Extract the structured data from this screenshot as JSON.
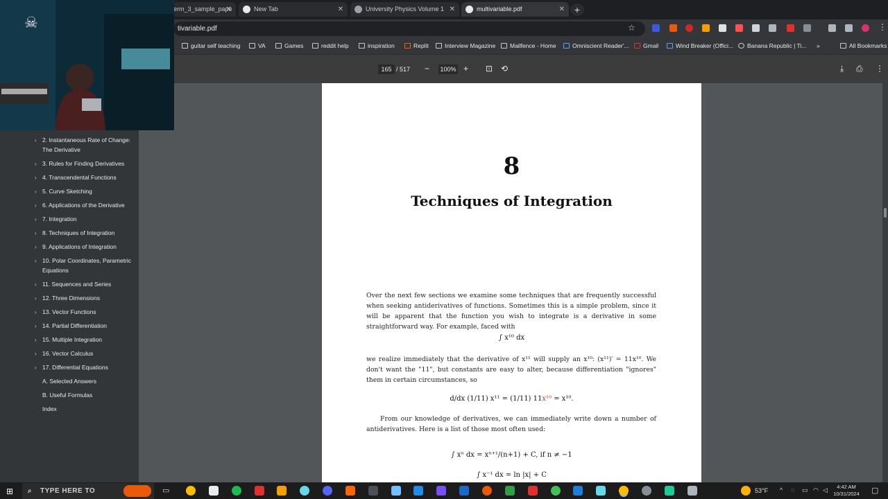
{
  "tabs": [
    {
      "title": "erm_3_sample_pape",
      "active": false
    },
    {
      "title": "New Tab",
      "active": false
    },
    {
      "title": "University Physics Volume 1",
      "active": false
    },
    {
      "title": "multivariable.pdf",
      "active": true
    }
  ],
  "address": {
    "url": "tivariable.pdf"
  },
  "bookmarks": [
    "guitar self teaching",
    "VA",
    "Games",
    "reddit help",
    "inspiration",
    "Replit",
    "Interview Magazine",
    "Mailfence - Home",
    "Omniscient Reader'...",
    "Gmail",
    "Wind Breaker (Offici...",
    "Banana Republic | Ti..."
  ],
  "bookmarks_more": "»",
  "bookmarks_all": "All Bookmarks",
  "pdf_toolbar": {
    "page_current": "165",
    "page_total": "/ 517",
    "zoom": "100%"
  },
  "outline": [
    "2. Instantaneous Rate of Change: The Derivative",
    "3. Rules for Finding Derivatives",
    "4. Transcendental Functions",
    "5. Curve Sketching",
    "6. Applications of the Derivative",
    "7. Integration",
    "8. Techniques of Integration",
    "9. Applications of Integration",
    "10. Polar Coordinates, Parametric Equations",
    "11. Sequences and Series",
    "12. Three Dimensions",
    "13. Vector Functions",
    "14. Partial Differentiation",
    "15. Multiple Integration",
    "16. Vector Calculus",
    "17. Differential Equations",
    "A. Selected Answers",
    "B. Useful Formulas",
    "Index"
  ],
  "document": {
    "chapter_number": "8",
    "chapter_title": "Techniques of Integration",
    "para1": "Over the next few sections we examine some techniques that are frequently successful when seeking antiderivatives of functions. Sometimes this is a simple problem, since it will be apparent that the function you wish to integrate is a derivative in some straightforward way. For example, faced with",
    "eq1": "∫ x¹⁰ dx",
    "para2": "we realize immediately that the derivative of x¹¹ will supply an x¹⁰: (x¹¹)′ = 11x¹⁰. We don't want the \"11\", but constants are easy to alter, because differentiation \"ignores\" them in certain circumstances, so",
    "eq2_left": "d/dx (1/11) x¹¹ = (1/11) 11",
    "eq2_red": "x¹⁰",
    "eq2_right": " = x¹⁰.",
    "para3": "From our knowledge of derivatives, we can immediately write down a number of antiderivatives. Here is a list of those most often used:",
    "eq3": "∫ xⁿ dx = xⁿ⁺¹/(n+1) + C,    if n ≠ −1",
    "eq4": "∫ x⁻¹ dx = ln |x| + C"
  },
  "taskbar": {
    "search_placeholder": "TYPE HERE TO",
    "temperature": "53°F",
    "time": "4:42 AM",
    "date": "10/31/2024"
  },
  "colors": {
    "accent": "#8ab4f8",
    "page_bg": "#ffffff",
    "viewer_bg": "#525659"
  }
}
